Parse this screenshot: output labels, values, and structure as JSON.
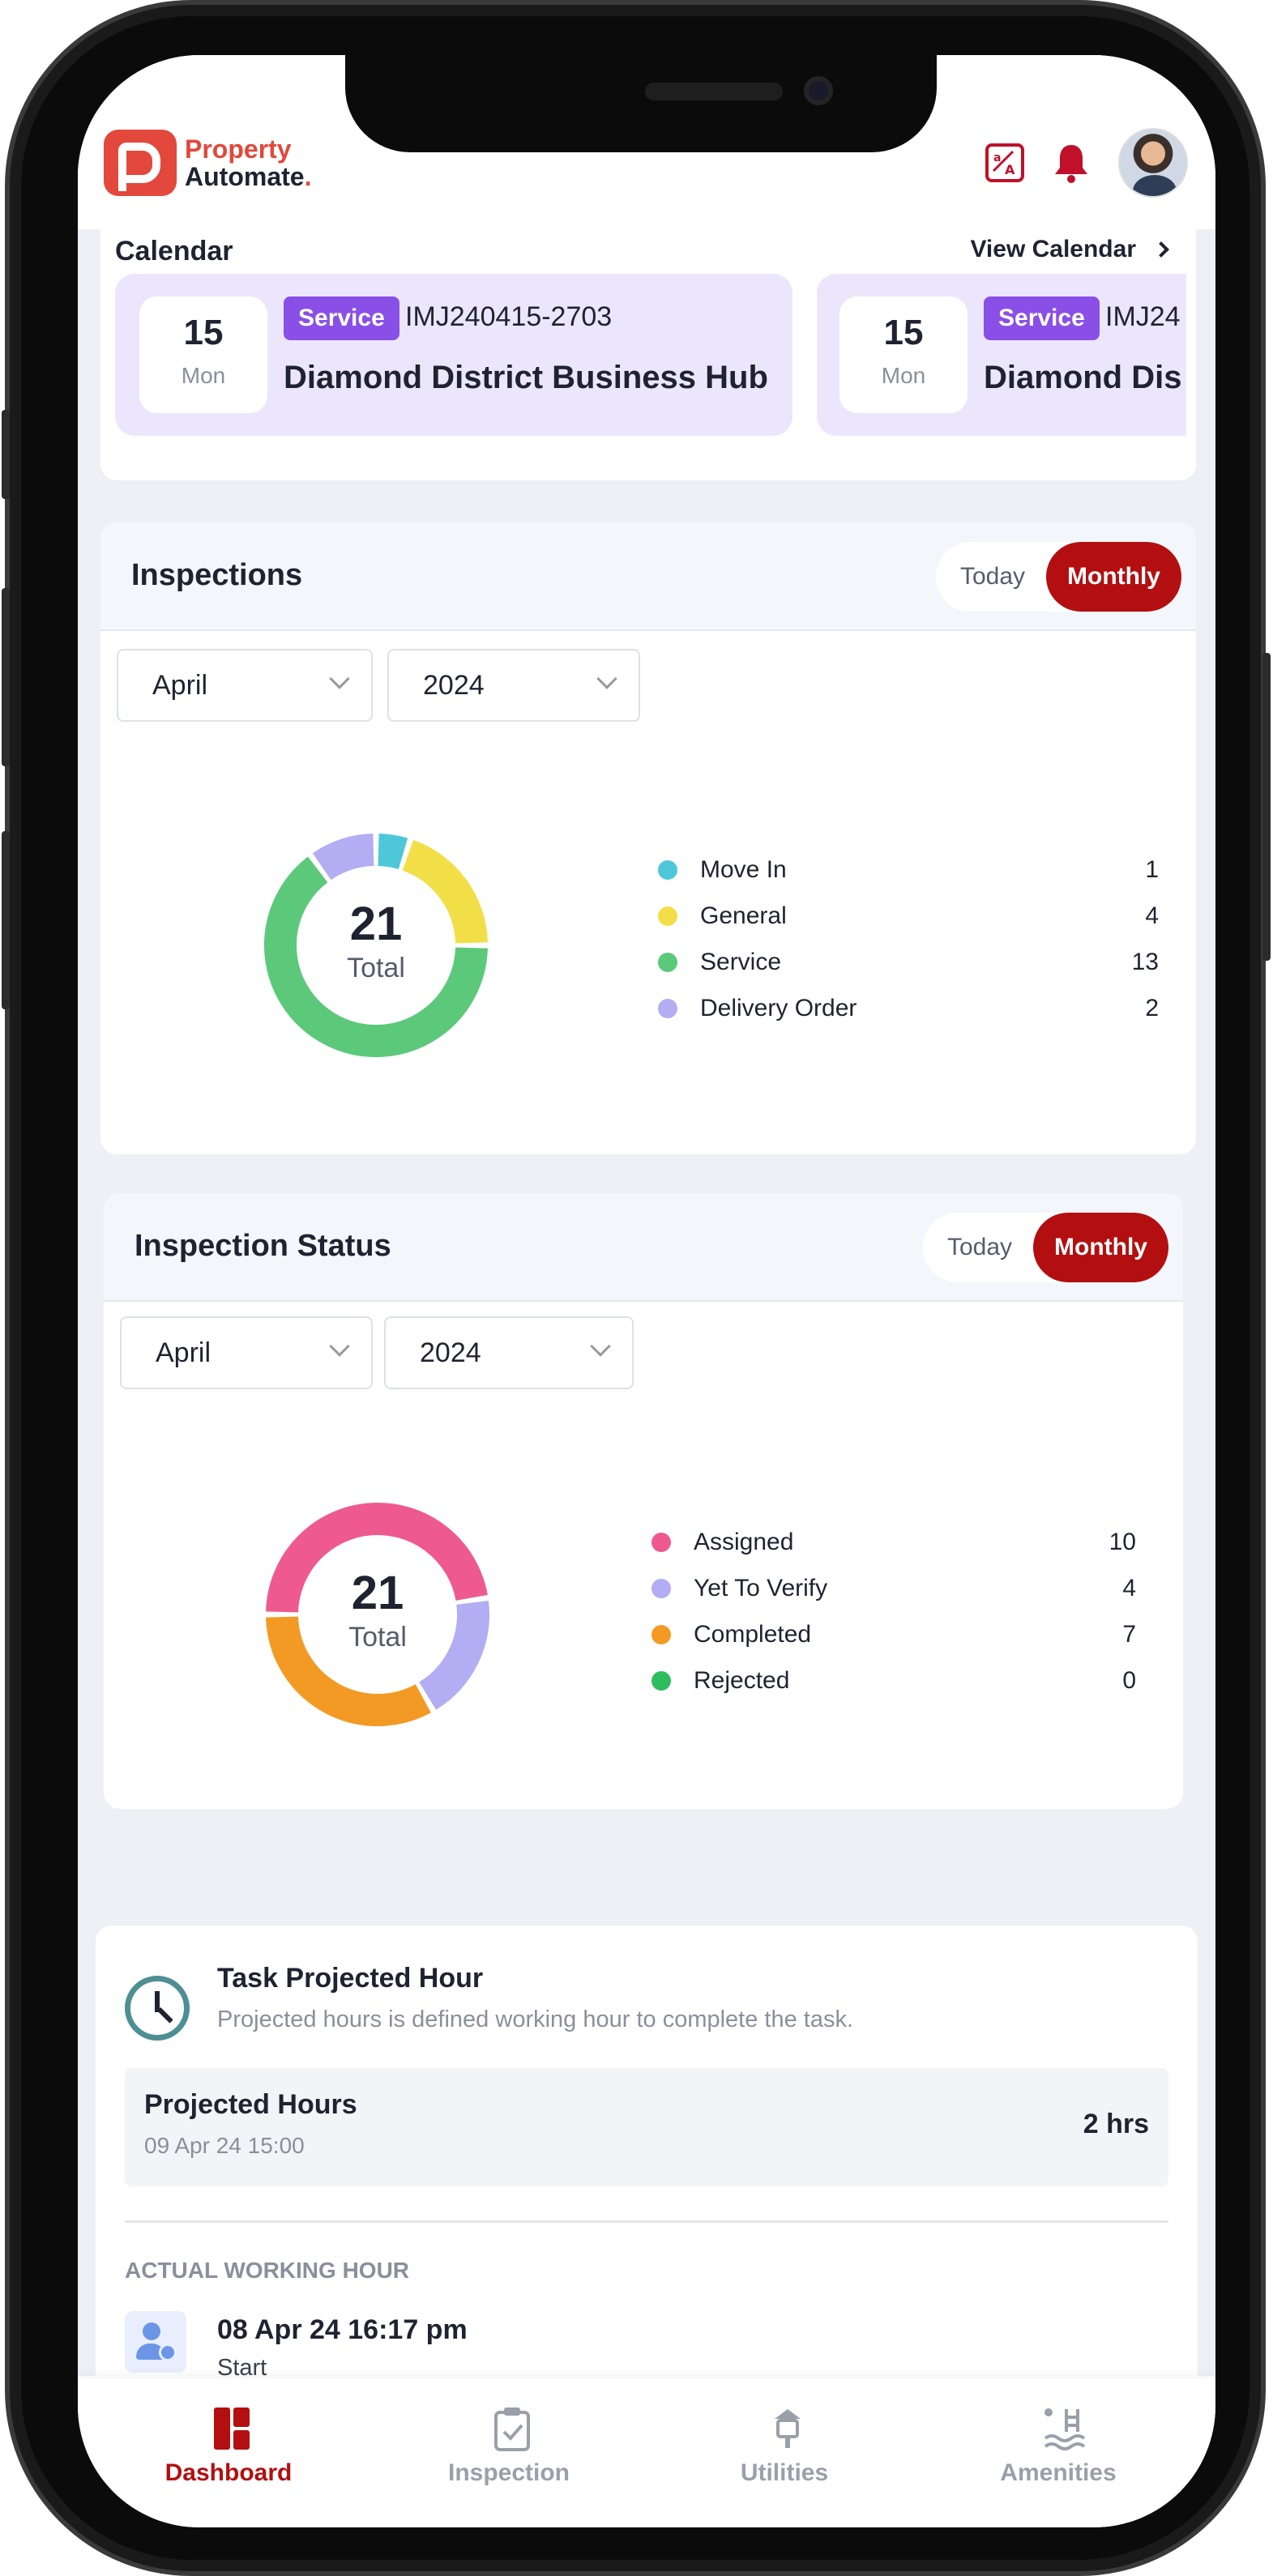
{
  "app": {
    "logo_line1": "Property",
    "logo_line2": "Automate",
    "logo_dot": "."
  },
  "header_icons": [
    "translate-icon",
    "bell-icon",
    "avatar"
  ],
  "calendar": {
    "title": "Calendar",
    "view_link": "View Calendar",
    "items": [
      {
        "day": "15",
        "weekday": "Mon",
        "badge": "Service",
        "code": "IMJ240415-2703",
        "name": "Diamond District Business Hub"
      },
      {
        "day": "15",
        "weekday": "Mon",
        "badge": "Service",
        "code": "IMJ24",
        "name": "Diamond Dis"
      }
    ]
  },
  "inspections": {
    "title": "Inspections",
    "toggle": {
      "today": "Today",
      "monthly": "Monthly",
      "selected": "Monthly"
    },
    "month": "April",
    "year": "2024",
    "total": "21",
    "total_label": "Total",
    "legend": [
      {
        "label": "Move In",
        "value": "1",
        "color": "#4ec7d9"
      },
      {
        "label": "General",
        "value": "4",
        "color": "#f2df48"
      },
      {
        "label": "Service",
        "value": "13",
        "color": "#5cc97a"
      },
      {
        "label": "Delivery Order",
        "value": "2",
        "color": "#b3adf3"
      }
    ]
  },
  "inspection_status": {
    "title": "Inspection Status",
    "toggle": {
      "today": "Today",
      "monthly": "Monthly",
      "selected": "Monthly"
    },
    "month": "April",
    "year": "2024",
    "total": "21",
    "total_label": "Total",
    "legend": [
      {
        "label": "Assigned",
        "value": "10",
        "color": "#ee5a8e"
      },
      {
        "label": "Yet To Verify",
        "value": "4",
        "color": "#b3adf3"
      },
      {
        "label": "Completed",
        "value": "7",
        "color": "#f39a25"
      },
      {
        "label": "Rejected",
        "value": "0",
        "color": "#2ebd5d"
      }
    ]
  },
  "chart_data": [
    {
      "type": "pie",
      "title": "Inspections",
      "categories": [
        "Move In",
        "General",
        "Service",
        "Delivery Order"
      ],
      "values": [
        1,
        4,
        13,
        2
      ],
      "colors": [
        "#4ec7d9",
        "#f2df48",
        "#5cc97a",
        "#b3adf3"
      ],
      "center_text": "21 Total",
      "legend": "right"
    },
    {
      "type": "pie",
      "title": "Inspection Status",
      "categories": [
        "Assigned",
        "Yet To Verify",
        "Completed",
        "Rejected"
      ],
      "values": [
        10,
        4,
        7,
        0
      ],
      "colors": [
        "#ee5a8e",
        "#b3adf3",
        "#f39a25",
        "#2ebd5d"
      ],
      "center_text": "21 Total",
      "legend": "right"
    }
  ],
  "task": {
    "title": "Task Projected Hour",
    "subtitle": "Projected hours is defined working hour to complete the task.",
    "projected_label": "Projected Hours",
    "projected_date": "09 Apr 24 15:00",
    "projected_value": "2 hrs",
    "actual_heading": "ACTUAL WORKING HOUR",
    "entries": [
      {
        "time": "08 Apr 24 16:17 pm",
        "status": "Start"
      }
    ]
  },
  "nav": [
    {
      "label": "Dashboard",
      "icon": "dashboard-icon",
      "active": true
    },
    {
      "label": "Inspection",
      "icon": "clipboard-check-icon",
      "active": false
    },
    {
      "label": "Utilities",
      "icon": "lamp-icon",
      "active": false
    },
    {
      "label": "Amenities",
      "icon": "pool-icon",
      "active": false
    }
  ]
}
